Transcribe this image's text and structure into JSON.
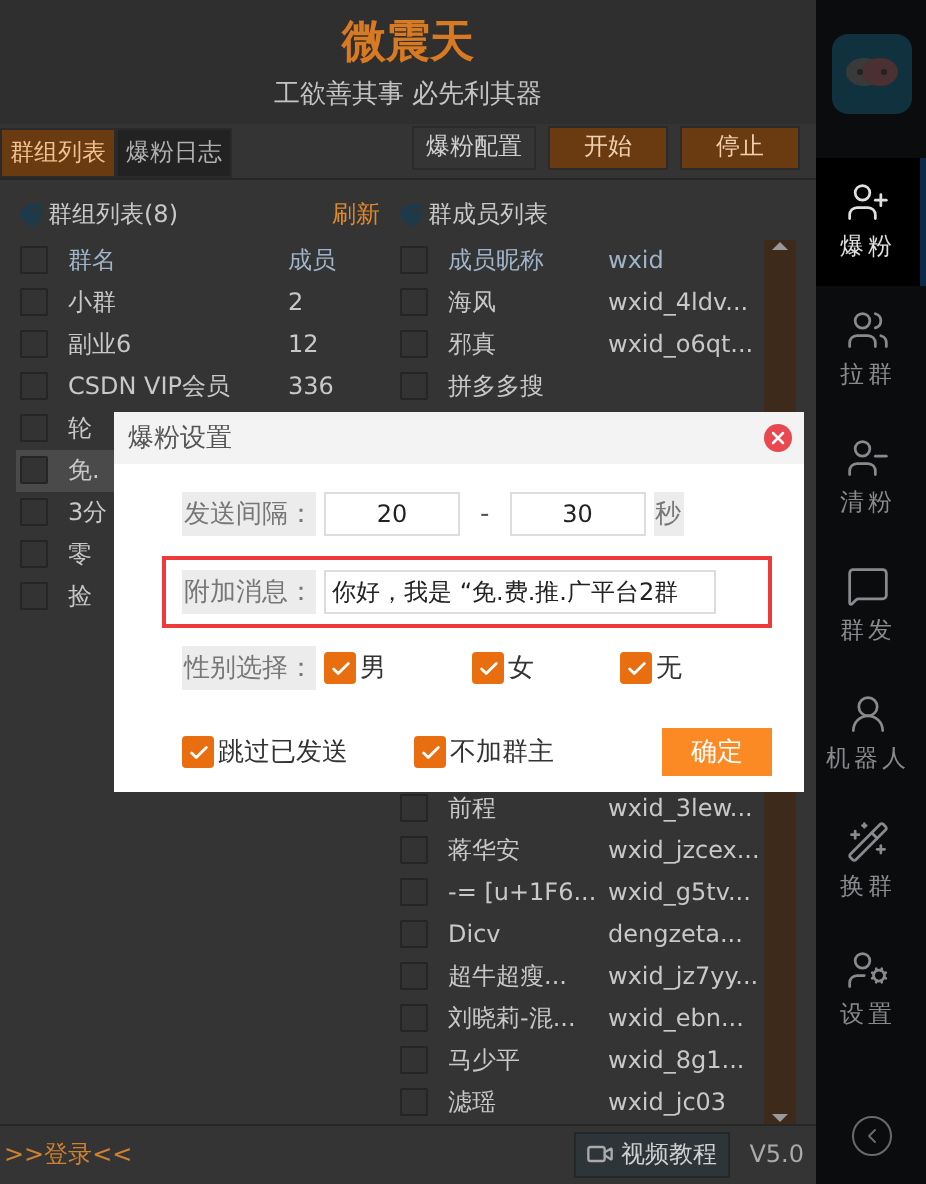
{
  "app": {
    "title": "微震天",
    "slogan": "工欲善其事 必先利其器"
  },
  "tabs": [
    {
      "label": "群组列表",
      "selected": true
    },
    {
      "label": "爆粉日志",
      "selected": false
    }
  ],
  "toolbar": {
    "config_button": "爆粉配置",
    "start_button": "开始",
    "stop_button": "停止"
  },
  "group_panel": {
    "title": "群组列表(8)",
    "refresh_link": "刷新",
    "columns": [
      "群名",
      "成员"
    ],
    "all_checked": false,
    "rows": [
      {
        "name": "小群",
        "members": "2",
        "checked": false,
        "selected": false
      },
      {
        "name": "副业6",
        "members": "12",
        "checked": false,
        "selected": false
      },
      {
        "name": "CSDN VIP会员",
        "members": "336",
        "checked": false,
        "selected": false
      },
      {
        "name": "轮",
        "checked": false,
        "selected": false
      },
      {
        "name": "免.",
        "checked": false,
        "selected": true
      },
      {
        "name": "3分",
        "checked": false,
        "selected": false
      },
      {
        "name": "零",
        "checked": false,
        "selected": false
      },
      {
        "name": "捡",
        "checked": false,
        "selected": false
      }
    ]
  },
  "member_panel": {
    "title": "群成员列表",
    "columns": [
      "成员昵称",
      "wxid"
    ],
    "all_checked": false,
    "rows_above": [
      {
        "nickname": "海风",
        "wxid": "wxid_4ldv...",
        "checked": false
      },
      {
        "nickname": "邪真",
        "wxid": "wxid_o6qt...",
        "checked": false
      },
      {
        "nickname": "拼多多搜",
        "checked": false
      }
    ],
    "rows_below": [
      {
        "nickname": "前程",
        "wxid": "wxid_3lew...",
        "checked": false
      },
      {
        "nickname": "蒋华安",
        "wxid": "wxid_jzcex...",
        "checked": false
      },
      {
        "nickname": "-= [u+1F6...",
        "wxid": "wxid_g5tv...",
        "checked": false
      },
      {
        "nickname": "Dicv",
        "wxid": "dengzeta...",
        "checked": false
      },
      {
        "nickname": "超牛超瘦...",
        "wxid": "wxid_jz7yy...",
        "checked": false
      },
      {
        "nickname": "刘晓莉-混...",
        "wxid": "wxid_ebn...",
        "checked": false
      },
      {
        "nickname": "马少平",
        "wxid": "wxid_8g1...",
        "checked": false
      },
      {
        "nickname": "滤瑶",
        "wxid": "wxid_jc03",
        "checked": false
      }
    ]
  },
  "footer": {
    "login_link": ">>登录<<",
    "tutorial_button": "视频教程",
    "version": "V5.0"
  },
  "sidebar": {
    "items": [
      {
        "label": "爆粉",
        "kind": "add",
        "selected": true
      },
      {
        "label": "拉群",
        "kind": "group",
        "selected": false
      },
      {
        "label": "清粉",
        "kind": "clean",
        "selected": false
      },
      {
        "label": "群发",
        "kind": "broadcast",
        "selected": false
      },
      {
        "label": "机器人",
        "kind": "robot",
        "selected": false
      },
      {
        "label": "换群",
        "kind": "switch",
        "selected": false
      },
      {
        "label": "设置",
        "kind": "settings",
        "selected": false
      }
    ]
  },
  "dialog": {
    "title": "爆粉设置",
    "interval": {
      "label": "发送间隔：",
      "min": "20",
      "separator": "-",
      "max": "30",
      "unit": "秒"
    },
    "message": {
      "label": "附加消息：",
      "value": "你好，我是 “免.费.推.广平台2群",
      "highlighted": true
    },
    "gender": {
      "label": "性别选择：",
      "options": [
        {
          "label": "男",
          "checked": true
        },
        {
          "label": "女",
          "checked": true
        },
        {
          "label": "无",
          "checked": true
        }
      ]
    },
    "options": [
      {
        "label": "跳过已发送",
        "checked": true
      },
      {
        "label": "不加群主",
        "checked": true
      }
    ],
    "confirm_button": "确定"
  }
}
